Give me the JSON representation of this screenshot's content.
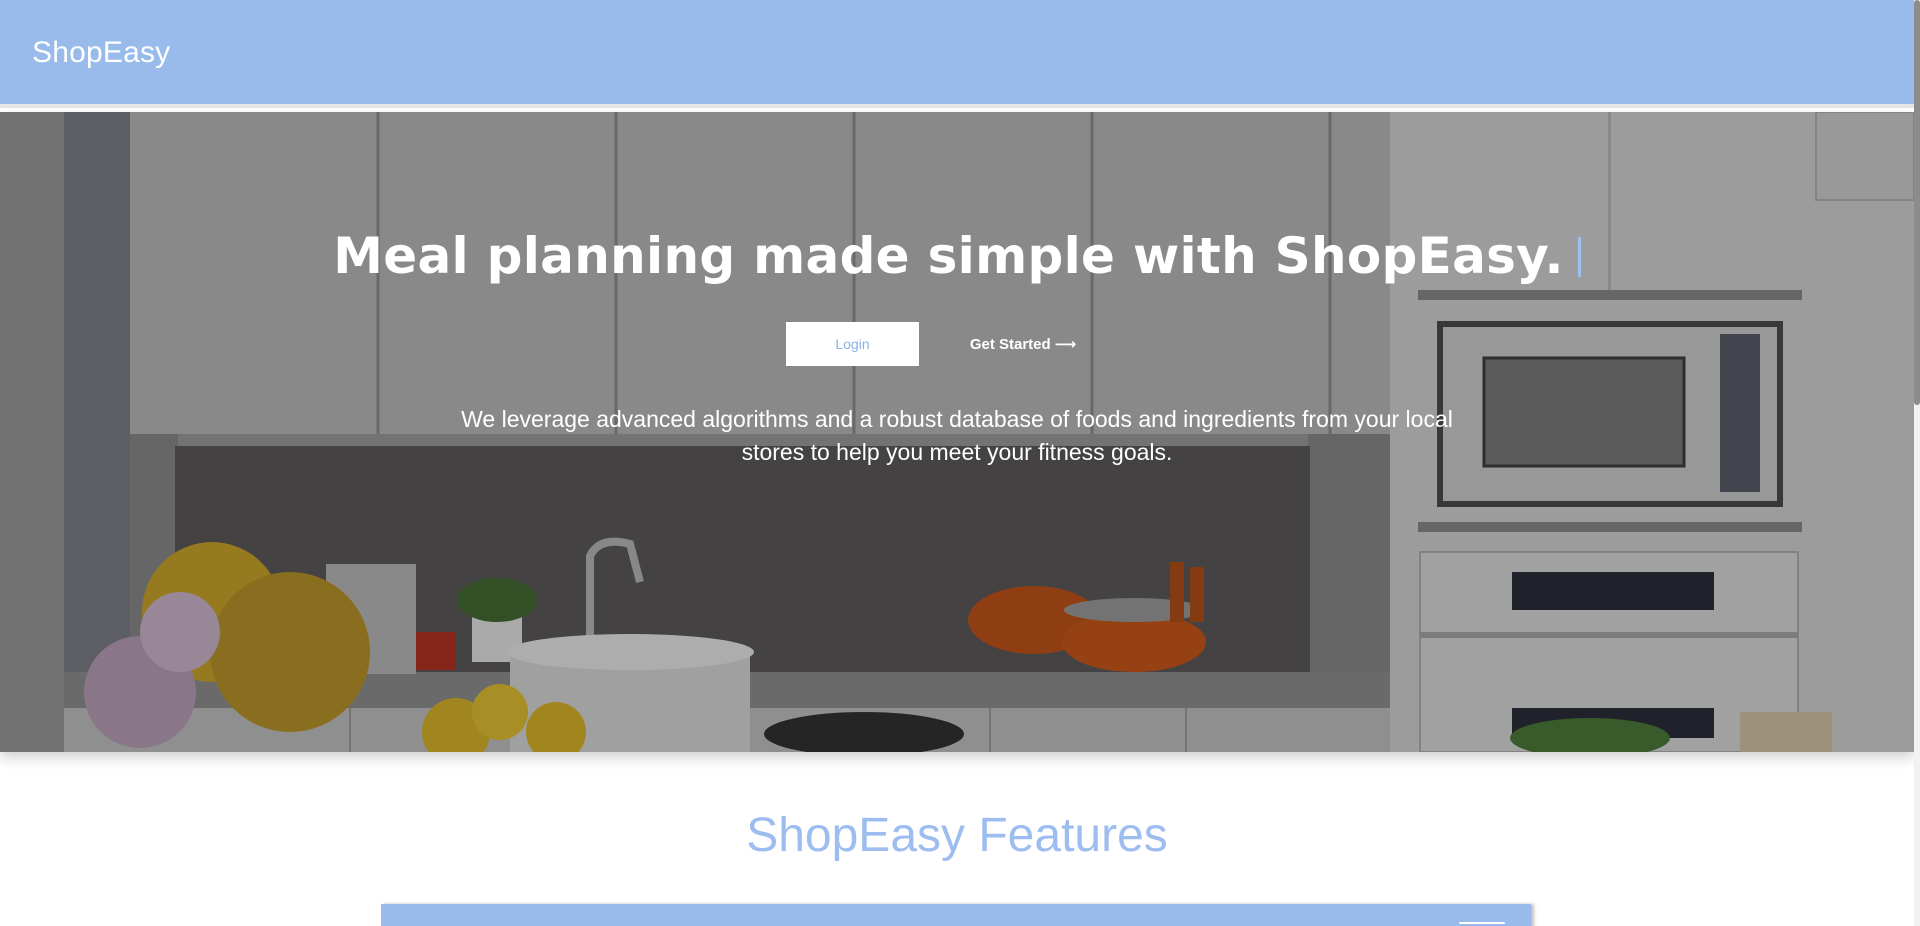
{
  "header": {
    "brand": "ShopEasy",
    "background_color": "#98bbeb"
  },
  "hero": {
    "title": "Meal planning made simple with ShopEasy.",
    "login_label": "Login",
    "get_started_label": "Get Started",
    "get_started_arrow": "⟶",
    "description": "We leverage advanced algorithms and a robust database of foods and ingredients from your local stores to help you meet your fitness goals."
  },
  "features": {
    "title": "ShopEasy Features"
  },
  "colors": {
    "accent": "#98bbeb",
    "features_title": "#9dbdf0",
    "login_text": "#8fb1e4"
  }
}
